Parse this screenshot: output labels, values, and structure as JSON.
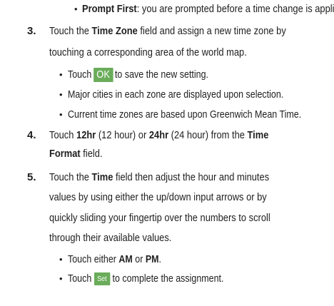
{
  "prompt_first": {
    "term": "Prompt First",
    "text": ": you are prompted before a time change is applied."
  },
  "step3": {
    "number": "3.",
    "line1_pre": "Touch the ",
    "field": "Time Zone",
    "line1_post": " field and assign a new time zone by",
    "line2": "touching a corresponding area of the world map.",
    "sub1_pre": "Touch",
    "ok_label": "OK",
    "sub1_post": "to save the new setting.",
    "sub2": "Major cities in each zone are displayed upon selection.",
    "sub3": "Current time zones are based upon Greenwich Mean Time."
  },
  "step4": {
    "number": "4.",
    "pre": "Touch ",
    "opt1": "12hr",
    "mid1": " (12 hour) or ",
    "opt2": "24hr",
    "mid2": " (24 hour) from the ",
    "field_a": "Time",
    "field_b": "Format",
    "post": " field."
  },
  "step5": {
    "number": "5.",
    "line1_pre": "Touch the ",
    "field": "Time",
    "line1_post": " field then adjust the hour and minutes",
    "line2": "values by using either the up/down input arrows or by",
    "line3": "quickly sliding your fingertip over the numbers to scroll",
    "line4": "through their available values.",
    "sub1_pre": "Touch either ",
    "am": "AM",
    "sub1_mid": " or ",
    "pm": "PM",
    "sub1_post": ".",
    "sub2_pre": "Touch",
    "set_label": "Set",
    "sub2_post": "to complete the assignment."
  }
}
